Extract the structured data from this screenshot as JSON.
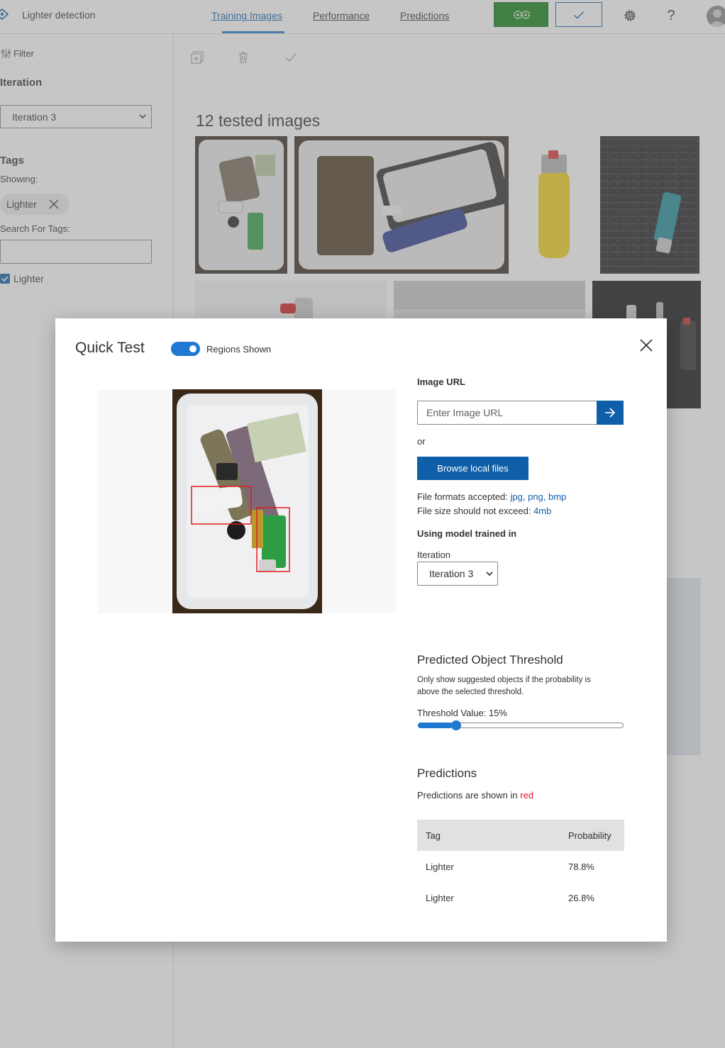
{
  "header": {
    "app_title": "Lighter detection",
    "tabs": [
      {
        "label": "Training Images",
        "active": true
      },
      {
        "label": "Performance",
        "active": false
      },
      {
        "label": "Predictions",
        "active": false
      }
    ],
    "train_icon": "gears-icon",
    "quick_test_icon": "checkmark-icon",
    "settings_icon": "gear-icon",
    "help_label": "?",
    "colors": {
      "train_button": "#0f8012",
      "accent": "#0f5fa8"
    }
  },
  "sidebar": {
    "filter_label": "Filter",
    "iteration_heading": "Iteration",
    "iteration_value": "Iteration 3",
    "tags_heading": "Tags",
    "showing_label": "Showing:",
    "active_tag": "Lighter",
    "search_label": "Search For Tags:",
    "search_value": "",
    "tag_list": [
      {
        "label": "Lighter",
        "checked": true
      }
    ]
  },
  "main": {
    "title": "12 tested images"
  },
  "quick_test": {
    "title": "Quick Test",
    "regions_toggle_label": "Regions Shown",
    "regions_shown": true,
    "image_url_label": "Image URL",
    "image_url_placeholder": "Enter Image URL",
    "or_label": "or",
    "browse_button": "Browse local files",
    "formats_prefix": "File formats accepted:",
    "formats_value": "jpg, png, bmp",
    "size_prefix": "File size should not exceed:",
    "size_value": "4mb",
    "model_heading": "Using model trained in",
    "iteration_label": "Iteration",
    "iteration_value": "Iteration 3",
    "threshold_heading": "Predicted Object Threshold",
    "threshold_desc": "Only show suggested objects if the probability is above the selected threshold.",
    "threshold_label": "Threshold Value: 15%",
    "threshold_fraction": 0.15,
    "predictions_heading": "Predictions",
    "predictions_note_prefix": "Predictions are shown in",
    "predictions_note_color": "red",
    "table": {
      "headers": {
        "tag": "Tag",
        "probability": "Probability"
      },
      "rows": [
        {
          "tag": "Lighter",
          "probability": "78.8%"
        },
        {
          "tag": "Lighter",
          "probability": "26.8%"
        }
      ]
    }
  }
}
